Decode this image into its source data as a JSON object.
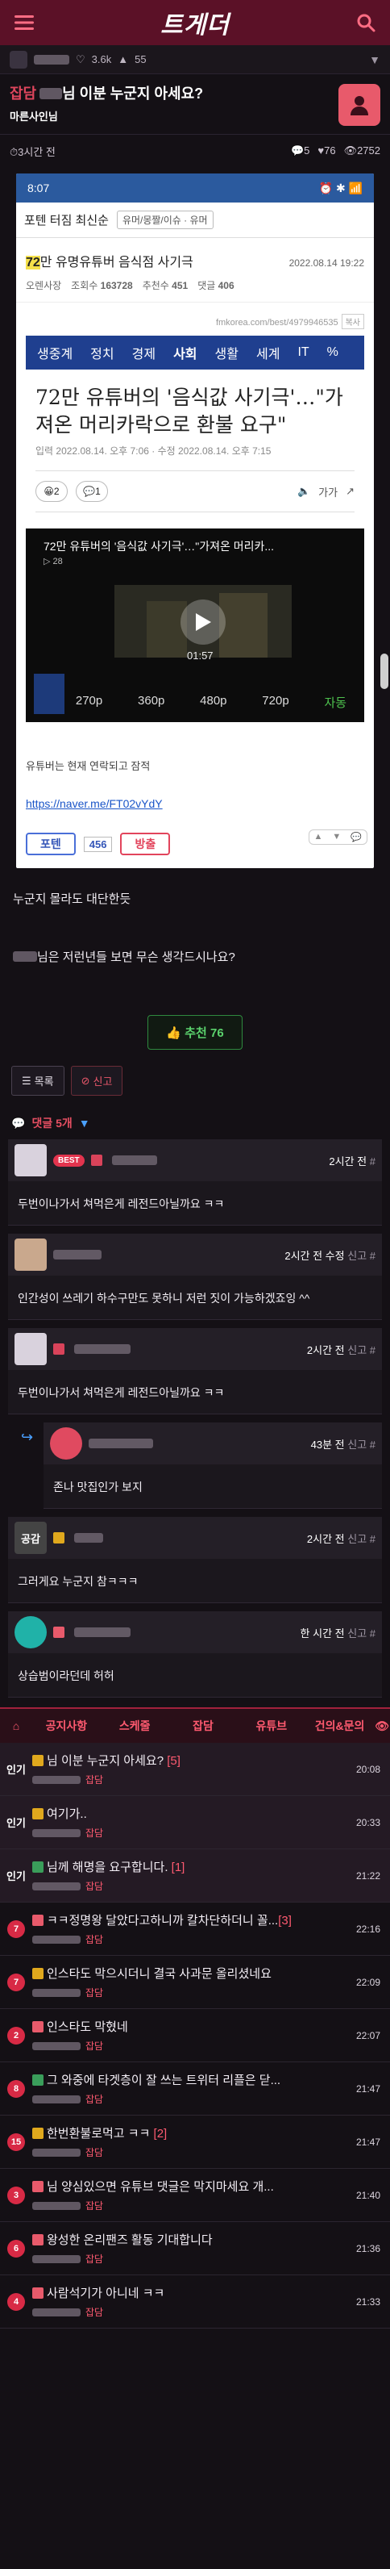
{
  "header": {
    "logo": "트게더"
  },
  "author_bar": {
    "followers": "3.6k",
    "points": "55"
  },
  "post": {
    "category": "잡담",
    "title_pre": "",
    "title_post": "님 이분 누군지 아세요?",
    "author": "마른사인님",
    "time": "3시간 전",
    "comments": "5",
    "likes": "76",
    "views": "2752"
  },
  "screenshot": {
    "time": "8:07",
    "status_right": "⏰ ✱ 📶 ",
    "board": "포텐 터짐 최신순",
    "board_pill": "유머/몽짤/이슈 · 유머",
    "title_num": "72",
    "title_rest": "만 유명유튜버 음식점 사기극",
    "date": "2022.08.14 19:22",
    "author": "오렌사장",
    "views_label": "조회수",
    "views": "163728",
    "recs_label": "추천수",
    "recs": "451",
    "cmts_label": "댓글",
    "cmts": "406",
    "url": "fmkorea.com/best/4979946535",
    "copy": "복사",
    "news_nav": [
      "생중계",
      "정치",
      "경제",
      "사회",
      "생활",
      "세계",
      "IT",
      "%"
    ],
    "headline": "72만 유튜버의 '음식값 사기극'…\"가져온 머리카락으로 환불 요구\"",
    "news_date": "입력 2022.08.14. 오후 7:06 · 수정 2022.08.14. 오후 7:15",
    "reaction_count": "2",
    "comment_count": "1",
    "font_label": "가가",
    "video_title": "72만 유튜버의 '음식값 사기극'…\"가져온 머리카...",
    "video_sub": "▷ 28",
    "duration": "01:57",
    "qualities": [
      "270p",
      "360p",
      "480p",
      "720p",
      "자동"
    ],
    "caption": "유튜버는 현재 연락되고 잠적",
    "link": "https://naver.me/FT02vYdY",
    "vote_good": "포텐",
    "vote_count": "456",
    "vote_bad": "방출"
  },
  "body": [
    "누군지 몰라도 대단한듯",
    "님은 저런년들 보면 무슨 생각드시나요?"
  ],
  "recommend": "추천 76",
  "actions": {
    "list": "목록",
    "report": "신고"
  },
  "comments_header": "댓글 5개",
  "comments": [
    {
      "badge": "BEST",
      "time": "2시간 전",
      "extra": "#",
      "text": "두번이나가서 쳐먹은게 레전드아닐까요 ㅋㅋ"
    },
    {
      "time": "2시간 전 수정",
      "extra": "신고 #",
      "text": "인간성이 쓰레기 하수구만도 못하니 저런 짓이 가능하겠죠잉 ^^"
    },
    {
      "time": "2시간 전",
      "extra": "신고 #",
      "text": "두번이나가서 쳐먹은게 레전드아닐까요 ㅋㅋ"
    },
    {
      "time": "43분 전",
      "extra": "신고 #",
      "text": "존나 맛집인가 보지"
    },
    {
      "nickname_tag": "공감",
      "time": "2시간 전",
      "extra": "신고 #",
      "text": "그러게요 누군지 참ㅋㅋㅋ"
    },
    {
      "time": "한 시간 전",
      "extra": "신고 #",
      "text": "상습범이라던데 허허"
    }
  ],
  "tabs": [
    "공지사항",
    "스케줄",
    "잡담",
    "유튜브",
    "건의&문의"
  ],
  "list": [
    {
      "num": "인기",
      "title": "님 이분 누군지 아세요? ",
      "cc": "[5]",
      "cat": "잡담",
      "time": "20:08"
    },
    {
      "num": "인기",
      "title": "여기가..",
      "cc": "",
      "cat": "잡담",
      "time": "20:33"
    },
    {
      "num": "인기",
      "title": "님께 해명을 요구합니다. ",
      "cc": "[1]",
      "cat": "잡담",
      "time": "21:22"
    },
    {
      "num": "7",
      "title": "ㅋㅋ정명왕 달았다고하니까 칼차단하더니 꼴...",
      "cc": "[3]",
      "cat": "잡담",
      "time": "22:16"
    },
    {
      "num": "7",
      "title": "인스타도 막으시더니 결국 사과문 올리셨네요",
      "cc": "",
      "cat": "잡담",
      "time": "22:09"
    },
    {
      "num": "2",
      "title": "인스타도 막혔네",
      "cc": "",
      "cat": "잡담",
      "time": "22:07"
    },
    {
      "num": "8",
      "title": "그 와중에 타겟층이 잘 쓰는 트위터 리플은 닫...",
      "cc": "",
      "cat": "잡담",
      "time": "21:47"
    },
    {
      "num": "15",
      "title": "한번환불로먹고 ㅋㅋ ",
      "cc": "[2]",
      "cat": "잡담",
      "time": "21:47"
    },
    {
      "num": "3",
      "title": "님 양심있으면 유튜브 댓글은 막지마세요 개...",
      "cc": "",
      "cat": "잡담",
      "time": "21:40"
    },
    {
      "num": "6",
      "title": "왕성한 온리팬즈 활동 기대합니다",
      "cc": "",
      "cat": "잡담",
      "time": "21:36"
    },
    {
      "num": "4",
      "title": "사람석기가 아니네 ㅋㅋ",
      "cc": "",
      "cat": "잡담",
      "time": "21:33"
    }
  ],
  "colors": {
    "brand": "#5b1127",
    "accent": "#ff5a70",
    "best": "#e3344e",
    "recommend": "#5bd26d"
  }
}
